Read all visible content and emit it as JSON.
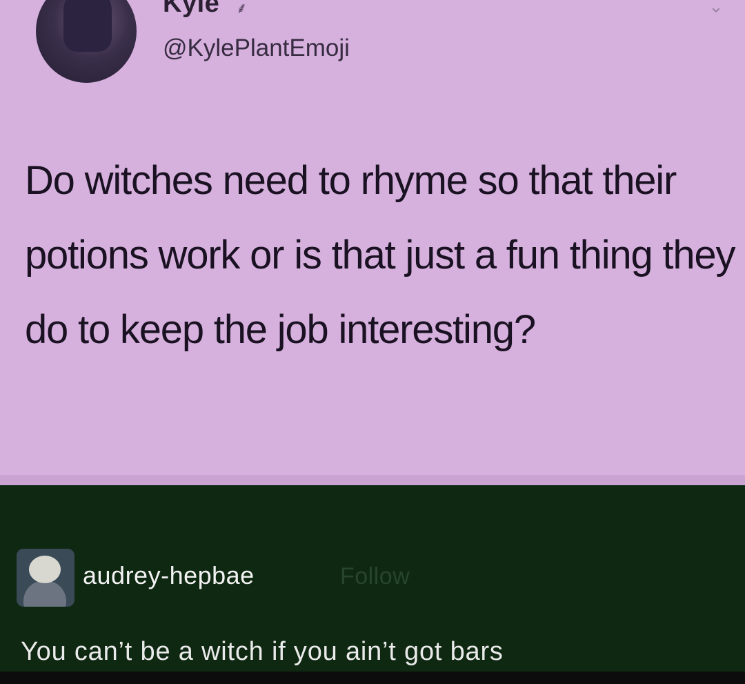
{
  "tweet": {
    "display_name": "Kyle",
    "handle": "@KylePlantEmoji",
    "text": "Do witches need to rhyme so that their potions work or is that just a fun thing they do to keep the job interesting?",
    "verified_icon": "plant-emoji-icon",
    "menu_icon": "chevron-down-icon",
    "background_color": "#d7b1de"
  },
  "reply": {
    "username": "audrey-hepbae",
    "follow_label": "Follow",
    "text": "You can’t be a witch if you ain’t got bars",
    "background_color": "#0f2812"
  }
}
